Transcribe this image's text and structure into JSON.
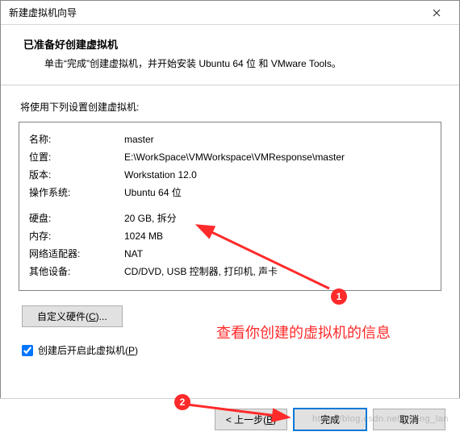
{
  "window": {
    "title": "新建虚拟机向导"
  },
  "header": {
    "heading": "已准备好创建虚拟机",
    "subheading": "单击“完成”创建虚拟机，并开始安装 Ubuntu 64 位 和 VMware Tools。"
  },
  "intro": "将使用下列设置创建虚拟机:",
  "props": {
    "name_label": "名称:",
    "name_value": "master",
    "location_label": "位置:",
    "location_value": "E:\\WorkSpace\\VMWorkspace\\VMResponse\\master",
    "version_label": "版本:",
    "version_value": "Workstation 12.0",
    "os_label": "操作系统:",
    "os_value": "Ubuntu 64 位",
    "disk_label": "硬盘:",
    "disk_value": "20 GB, 拆分",
    "memory_label": "内存:",
    "memory_value": "1024 MB",
    "nic_label": "网络适配器:",
    "nic_value": "NAT",
    "other_label": "其他设备:",
    "other_value": "CD/DVD, USB 控制器, 打印机, 声卡"
  },
  "customize": {
    "label_pre": "自定义硬件(",
    "label_hot": "C",
    "label_post": ")..."
  },
  "power_on": {
    "checked": true,
    "label_pre": "创建后开启此虚拟机(",
    "label_hot": "P",
    "label_post": ")"
  },
  "footer": {
    "back_pre": "< 上一步(",
    "back_hot": "B",
    "back_post": ")",
    "finish": "完成",
    "cancel": "取消"
  },
  "annotation": {
    "text": "查看你创建的虚拟机的信息",
    "badge1": "1",
    "badge2": "2"
  },
  "watermark": "https://blog.csdn.net/Zheng_lan"
}
